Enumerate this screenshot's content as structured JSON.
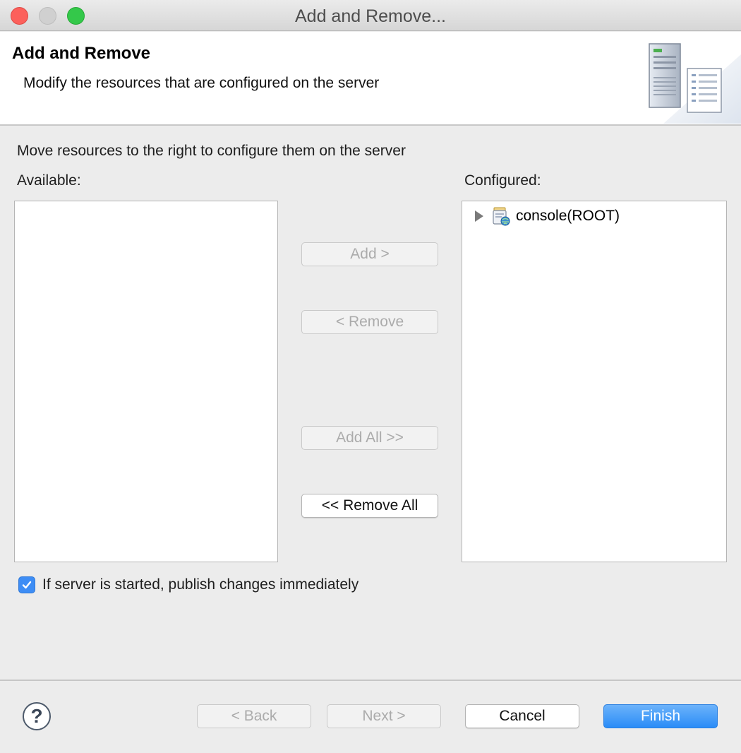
{
  "window": {
    "title": "Add and Remove..."
  },
  "header": {
    "title": "Add and Remove",
    "description": "Modify the resources that are configured on the server"
  },
  "main": {
    "instruction": "Move resources to the right to configure them on the server",
    "available_label": "Available:",
    "configured_label": "Configured:",
    "available_items": [],
    "configured_items": [
      {
        "label": "console(ROOT)",
        "expanded": false
      }
    ]
  },
  "buttons": {
    "add": "Add >",
    "remove": "< Remove",
    "add_all": "Add All >>",
    "remove_all": "<< Remove All"
  },
  "options": {
    "publish_label": "If server is started, publish changes immediately",
    "publish_checked": true
  },
  "footer": {
    "help_symbol": "?",
    "back": "< Back",
    "next": "Next >",
    "cancel": "Cancel",
    "finish": "Finish"
  },
  "colors": {
    "accent": "#2a8cf7",
    "checkbox": "#3d8df5",
    "close": "#fc605b",
    "maximize": "#34c84a"
  },
  "icons": {
    "tree_expander": "chevron-right-icon",
    "module": "web-module-icon",
    "header_art": "server-icon",
    "help": "help-icon"
  }
}
